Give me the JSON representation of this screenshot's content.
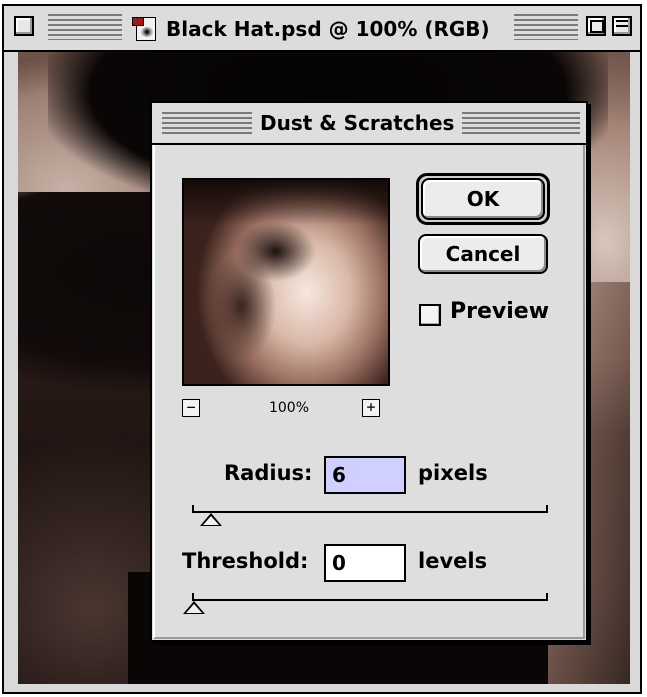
{
  "window": {
    "title": "Black Hat.psd @ 100% (RGB)",
    "controls": [
      "close-box",
      "zoom-box",
      "collapse-box"
    ]
  },
  "dialog": {
    "title": "Dust & Scratches",
    "buttons": {
      "ok_label": "OK",
      "cancel_label": "Cancel"
    },
    "preview": {
      "label": "Preview",
      "checked": false,
      "zoom_level": "100%",
      "zoom_out": "−",
      "zoom_in": "+"
    },
    "radius": {
      "label": "Radius:",
      "value": "6",
      "unit": "pixels",
      "min": 1,
      "max": 100,
      "slider_value": 6
    },
    "threshold": {
      "label": "Threshold:",
      "value": "0",
      "unit": "levels",
      "min": 0,
      "max": 255,
      "slider_value": 0
    }
  },
  "colors": {
    "dialog_bg": "#dedede",
    "focused_field": "#cfd0ff",
    "icon_red": "#9b1b1b"
  }
}
